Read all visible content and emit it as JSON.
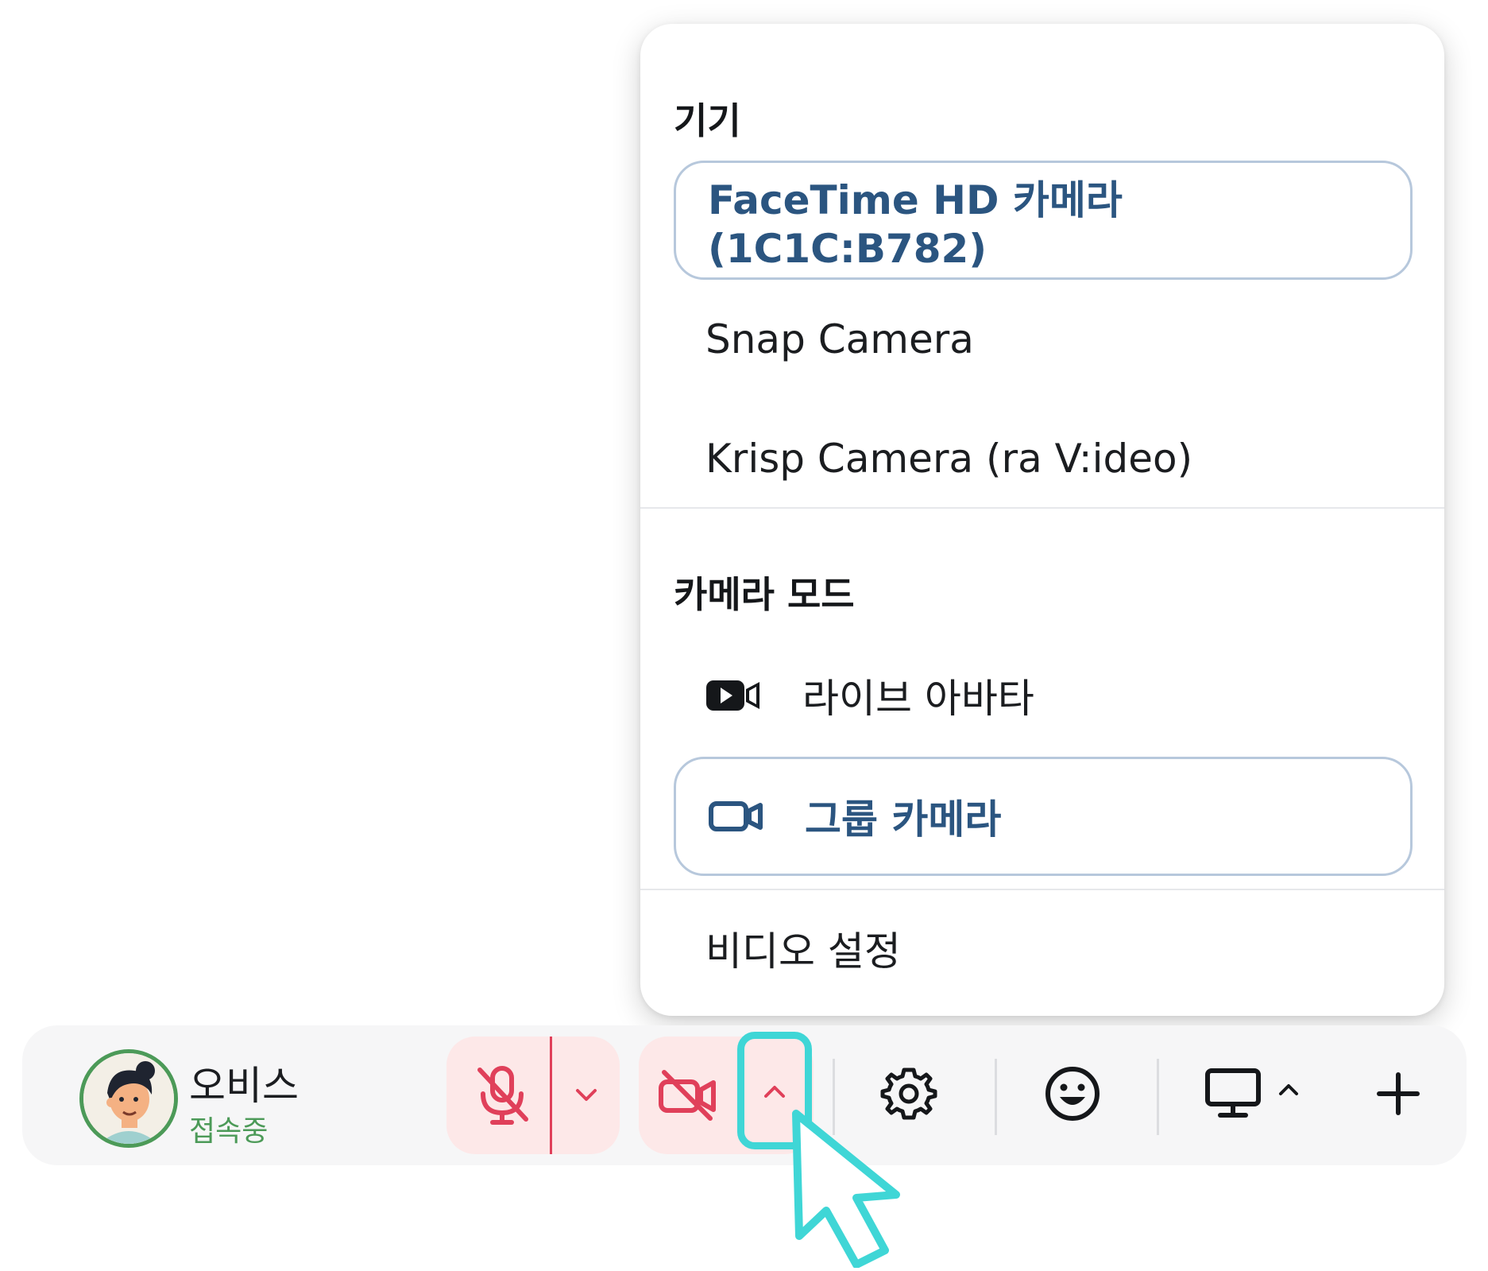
{
  "menu": {
    "devices_title": "기기",
    "devices": [
      {
        "label": "FaceTime HD 카메라 (1C1C:B782)",
        "selected": true
      },
      {
        "label": "Snap Camera",
        "selected": false
      },
      {
        "label": "Krisp Camera (ra V:ideo)",
        "selected": false
      }
    ],
    "mode_title": "카메라 모드",
    "modes": [
      {
        "label": "라이브 아바타",
        "icon": "video-play-icon",
        "selected": false
      },
      {
        "label": "그룹 카메라",
        "icon": "video-camera-icon",
        "selected": true
      }
    ],
    "video_settings": "비디오 설정"
  },
  "toolbar": {
    "user": {
      "name": "오비스",
      "status": "접속중"
    },
    "icons": [
      "mic-off-icon",
      "chevron-down-icon",
      "camera-off-icon",
      "chevron-up-icon",
      "gear-icon",
      "smile-icon",
      "monitor-icon",
      "chevron-up-icon",
      "plus-icon"
    ]
  },
  "colors": {
    "accent": "#2b5580",
    "selected_border": "#b7c8dc",
    "danger": "#e0405a",
    "danger_bg": "#fde8e8",
    "online": "#4c9a58",
    "highlight": "#3fd6d6"
  }
}
